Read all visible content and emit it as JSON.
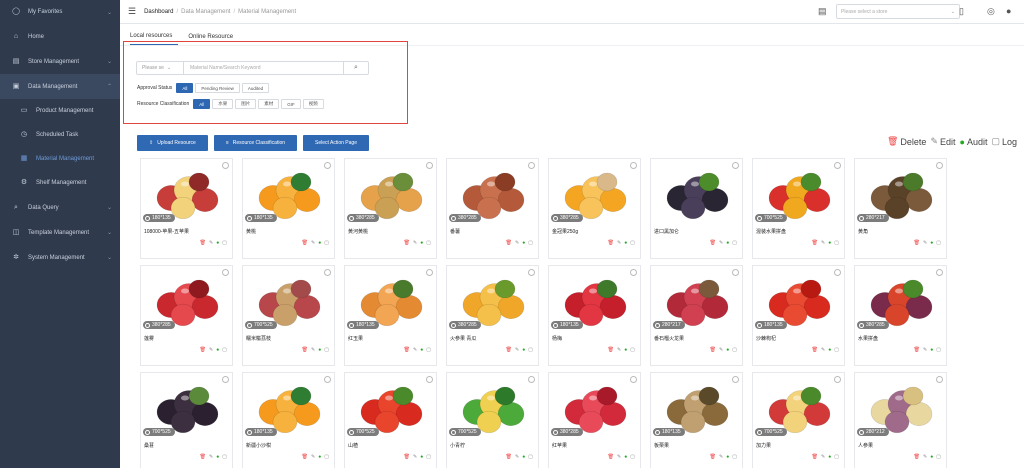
{
  "sidebar": {
    "items": [
      {
        "label": "My Favorites",
        "icon": "user-icon"
      },
      {
        "label": "Home",
        "icon": "home-icon"
      },
      {
        "label": "Store Management",
        "icon": "store-icon"
      },
      {
        "label": "Data Management",
        "icon": "database-icon"
      },
      {
        "label": "Product Management",
        "icon": "cart-icon"
      },
      {
        "label": "Scheduled Task",
        "icon": "clock-icon"
      },
      {
        "label": "Material Management",
        "icon": "image-icon"
      },
      {
        "label": "Shelf Management",
        "icon": "gear-icon"
      },
      {
        "label": "Data Query",
        "icon": "search-icon"
      },
      {
        "label": "Template Management",
        "icon": "template-icon"
      },
      {
        "label": "System Management",
        "icon": "settings-icon"
      }
    ]
  },
  "header": {
    "breadcrumb": [
      "Dashboard",
      "Data Management",
      "Material Management"
    ],
    "store_placeholder": "Please select a store"
  },
  "tabs": [
    "Local resources",
    "Online Resource"
  ],
  "filters": {
    "search_type": "Please se",
    "search_placeholder": "Material Name/Search Keyword",
    "approval_label": "Approval Status",
    "approval_options": [
      "All",
      "Pending Review",
      "Audited"
    ],
    "classification_label": "Resource Classification",
    "classification_options": [
      "All",
      "水果",
      "图片",
      "素材",
      "GIF",
      "视频"
    ]
  },
  "actions": {
    "upload": "Upload Resource",
    "classification": "Resource Classification",
    "select_action": "Select Action Page"
  },
  "legend": {
    "delete": "Delete",
    "edit": "Edit",
    "audit": "Audit",
    "log": "Log"
  },
  "colors": {
    "accent": "#2f68b3",
    "sidebar": "#2f3a4d",
    "highlight": "#e0453f"
  },
  "cards": [
    {
      "size": "180*135",
      "name": "108000-苹果-五苹果",
      "fruit": "apple-cut"
    },
    {
      "size": "180*135",
      "name": "黄桃",
      "fruit": "orange"
    },
    {
      "size": "380*285",
      "name": "黄河黄桃",
      "fruit": "apricots"
    },
    {
      "size": "380*285",
      "name": "番薯",
      "fruit": "sweet-potato"
    },
    {
      "size": "380*285",
      "name": "金冠果250g",
      "fruit": "physalis"
    },
    {
      "size": "",
      "name": "进口黑加仑",
      "fruit": "black-grapes"
    },
    {
      "size": "700*525",
      "name": "混装水果拼盘",
      "fruit": "mixed-fruit"
    },
    {
      "size": "280*217",
      "name": "黄角",
      "fruit": "brown-roots"
    },
    {
      "size": "380*285",
      "name": "莲雾",
      "fruit": "wax-apple"
    },
    {
      "size": "700*525",
      "name": "糯米糍荔枝",
      "fruit": "peach"
    },
    {
      "size": "180*135",
      "name": "红玉果",
      "fruit": "orange-small"
    },
    {
      "size": "380*285",
      "name": "火参果 青瓜",
      "fruit": "kiwano"
    },
    {
      "size": "180*135",
      "name": "杨梅",
      "fruit": "cherries"
    },
    {
      "size": "280*217",
      "name": "番石榴火龙果",
      "fruit": "pitaya"
    },
    {
      "size": "180*135",
      "name": "沙棘枸杞",
      "fruit": "goji"
    },
    {
      "size": "380*285",
      "name": "水果拼盘",
      "fruit": "fruit-plate"
    },
    {
      "size": "700*525",
      "name": "桑葚",
      "fruit": "mulberry"
    },
    {
      "size": "180*135",
      "name": "新疆小沙柑",
      "fruit": "orange"
    },
    {
      "size": "700*525",
      "name": "山楂",
      "fruit": "tomatoes"
    },
    {
      "size": "700*525",
      "name": "小青柠",
      "fruit": "mango"
    },
    {
      "size": "380*285",
      "name": "红苹果",
      "fruit": "red-apples"
    },
    {
      "size": "180*135",
      "name": "板栗果",
      "fruit": "figs"
    },
    {
      "size": "700*525",
      "name": "加力果",
      "fruit": "apple-cut2"
    },
    {
      "size": "280*212",
      "name": "人参果",
      "fruit": "pepino"
    }
  ]
}
